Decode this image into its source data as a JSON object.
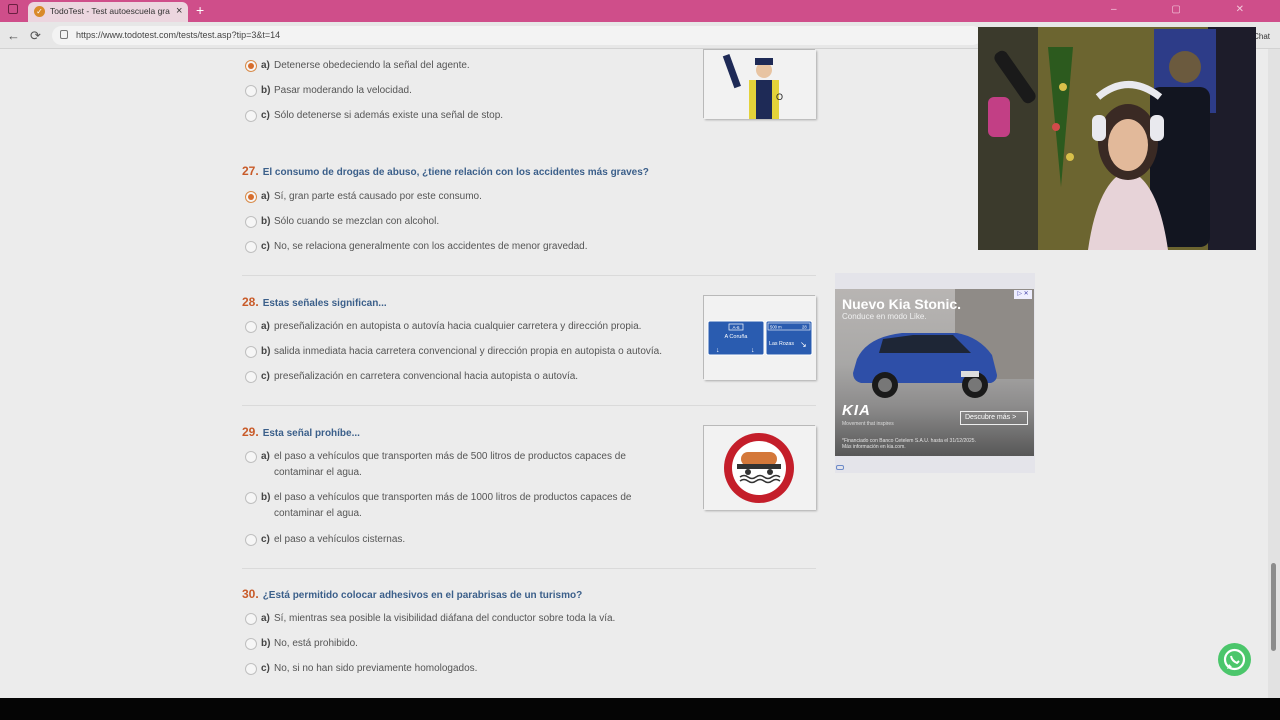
{
  "browser": {
    "tab_title": "TodoTest - Test autoescuela gratis",
    "tab_close": "×",
    "new_tab": "+",
    "url": "https://www.todotest.com/tests/test.asp?tip=3&t=14",
    "back": "←",
    "reload": "⟳",
    "chat_label": "Chat",
    "window_controls": "– ▢ ✕"
  },
  "questions": [
    {
      "number": "",
      "title": "",
      "options": [
        {
          "letter": "a)",
          "text": "Detenerse obedeciendo la señal del agente.",
          "selected": true
        },
        {
          "letter": "b)",
          "text": "Pasar moderando la velocidad.",
          "selected": false
        },
        {
          "letter": "c)",
          "text": "Sólo detenerse si además existe una señal de stop.",
          "selected": false
        }
      ]
    },
    {
      "number": "27.",
      "title": "El consumo de drogas de abuso, ¿tiene relación con los accidentes más graves?",
      "options": [
        {
          "letter": "a)",
          "text": "Sí, gran parte está causado por este consumo.",
          "selected": true
        },
        {
          "letter": "b)",
          "text": "Sólo cuando se mezclan con alcohol.",
          "selected": false
        },
        {
          "letter": "c)",
          "text": "No, se relaciona generalmente con los accidentes de menor gravedad.",
          "selected": false
        }
      ]
    },
    {
      "number": "28.",
      "title": "Estas señales significan...",
      "options": [
        {
          "letter": "a)",
          "text": "preseñalización en autopista o autovía hacia cualquier carretera y dirección propia.",
          "selected": false
        },
        {
          "letter": "b)",
          "text": "salida inmediata hacia carretera convencional y dirección propia en autopista o autovía.",
          "selected": false
        },
        {
          "letter": "c)",
          "text": "preseñalización en carretera convencional hacia autopista o autovía.",
          "selected": false
        }
      ]
    },
    {
      "number": "29.",
      "title": "Esta señal prohíbe...",
      "options": [
        {
          "letter": "a)",
          "text": "el paso a vehículos que transporten más de 500 litros de productos capaces de contaminar el agua.",
          "selected": false
        },
        {
          "letter": "b)",
          "text": "el paso a vehículos que transporten más de 1000 litros de productos capaces de contaminar el agua.",
          "selected": false
        },
        {
          "letter": "c)",
          "text": "el paso a vehículos cisternas.",
          "selected": false
        }
      ]
    },
    {
      "number": "30.",
      "title": "¿Está permitido colocar adhesivos en el parabrisas de un turismo?",
      "options": [
        {
          "letter": "a)",
          "text": "Sí, mientras sea posible la visibilidad diáfana del conductor sobre toda la vía.",
          "selected": false
        },
        {
          "letter": "b)",
          "text": "No, está prohibido.",
          "selected": false
        },
        {
          "letter": "c)",
          "text": "No, si no han sido previamente homologados.",
          "selected": false
        }
      ]
    }
  ],
  "signs": {
    "q28_left_road": "A-6",
    "q28_left_city": "A Coruña",
    "q28_right_dist": "500 m",
    "q28_right_exit": "28",
    "q28_right_city": "Las Rozas",
    "q26_badge": "O"
  },
  "ad": {
    "title": "Nuevo Kia Stonic.",
    "subtitle": "Conduce en modo Like.",
    "brand": "KIA",
    "slogan": "Movement that inspires",
    "cta": "Descubre más",
    "cta_arrow": ">",
    "legal": "*Financiado con Banco Cetelem S.A.U. hasta el 31/12/2025. Más información en kia.com.",
    "plate": "0000 ABC",
    "choices": "▷ ✕"
  },
  "colors": {
    "accent_orange": "#c85a28",
    "question_blue": "#3b5f8a",
    "tab_bar": "#cf4e8a",
    "whatsapp": "#4bc66b"
  }
}
